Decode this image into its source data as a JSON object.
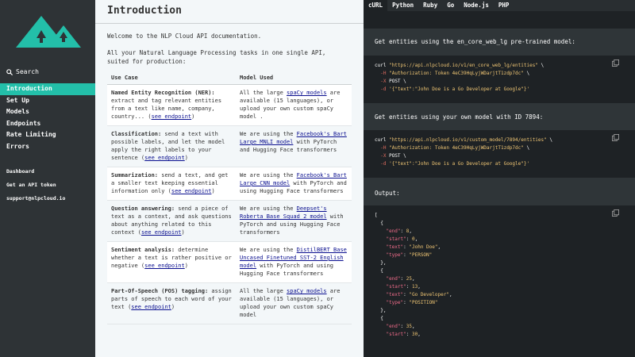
{
  "sidebar": {
    "search_label": "Search",
    "nav": [
      "Introduction",
      "Set Up",
      "Models",
      "Endpoints",
      "Rate Limiting",
      "Errors"
    ],
    "links": [
      "Dashboard",
      "Get an API token",
      "support@nlpcloud.io"
    ]
  },
  "main": {
    "title": "Introduction",
    "welcome": "Welcome to the NLP Cloud API documentation.",
    "intro": "All your Natural Language Processing tasks in one single API, suited for production:",
    "table_headers": [
      "Use Case",
      "Model Used"
    ],
    "see_endpoint": "see endpoint",
    "rows": [
      {
        "name": "Named Entity Recognition (NER):",
        "desc": " extract and tag relevant entities from a text like name, company, country... (",
        "model_pre": "All the large ",
        "model_link": "spaCy models",
        "model_post": " are available (15 languages), or upload your own custom spaCy model ."
      },
      {
        "name": "Classification:",
        "desc": " send a text with possible labels, and let the model apply the right labels to your sentence (",
        "model_pre": "We are using the ",
        "model_link": "Facebook's Bart Large MNLI model",
        "model_post": " with PyTorch and Hugging Face transformers"
      },
      {
        "name": "Summarization:",
        "desc": " send a text, and get a smaller text keeping essential information only (",
        "model_pre": "We are using the ",
        "model_link": "Facebook's Bart Large CNN model",
        "model_post": " with PyTorch and using Hugging Face transformers"
      },
      {
        "name": "Question answering:",
        "desc": " send a piece of text as a context, and ask questions about anything related to this context (",
        "model_pre": "We are using the ",
        "model_link": "Deepset's Roberta Base Squad 2 model",
        "model_post": " with PyTorch and using Hugging Face transformers"
      },
      {
        "name": "Sentiment analysis:",
        "desc": " determine whether a text is rather positive or negative (",
        "model_pre": "We are using the ",
        "model_link": "DistilBERT Base Uncased Finetuned SST-2 English model",
        "model_post": " with PyTorch and using Hugging Face transformers"
      },
      {
        "name": "Part-Of-Speech (POS) tagging:",
        "desc": " assign parts of speech to each word of your text (",
        "model_pre": "All the large ",
        "model_link": "spaCy models",
        "model_post": " are available (15 languages), or upload your own custom spaCy model"
      }
    ]
  },
  "code_panel": {
    "tabs": [
      "cURL",
      "Python",
      "Ruby",
      "Go",
      "Node.js",
      "PHP"
    ],
    "desc1": "Get entities using the en_core_web_lg pre-trained model:",
    "desc2": "Get entities using your own model with ID 7894:",
    "output_label": "Output:",
    "curl": "curl",
    "url1": "\"https://api.nlpcloud.io/v1/en_core_web_lg/entities\"",
    "url2": "\"https://api.nlpcloud.io/v1/custom_model/7894/entities\"",
    "flag_h": "-H",
    "flag_x": "-X",
    "flag_d": "-d",
    "auth": "\"Authorization: Token 4eC39HqLyjWDarjtT1zdp7dc\"",
    "method": "POST",
    "payload": "'{\"text\":\"John Doe is a Go Developer at Google\"}'",
    "bs": "\\",
    "output": [
      {
        "end": 8,
        "start": 0,
        "text": "\"John Doe\"",
        "type": "\"PERSON\""
      },
      {
        "end": 25,
        "start": 13,
        "text": "\"Go Developer\"",
        "type": "\"POSITION\""
      },
      {
        "end": 35,
        "start": 30
      }
    ]
  },
  "colors": {
    "sidebar_bg": "#2e3336",
    "accent": "#23bfa9",
    "code_bg": "#1e2225",
    "link": "#0a0f8f"
  },
  "icons": [
    "logo-mountains-icon",
    "search-icon",
    "copy-icon"
  ]
}
